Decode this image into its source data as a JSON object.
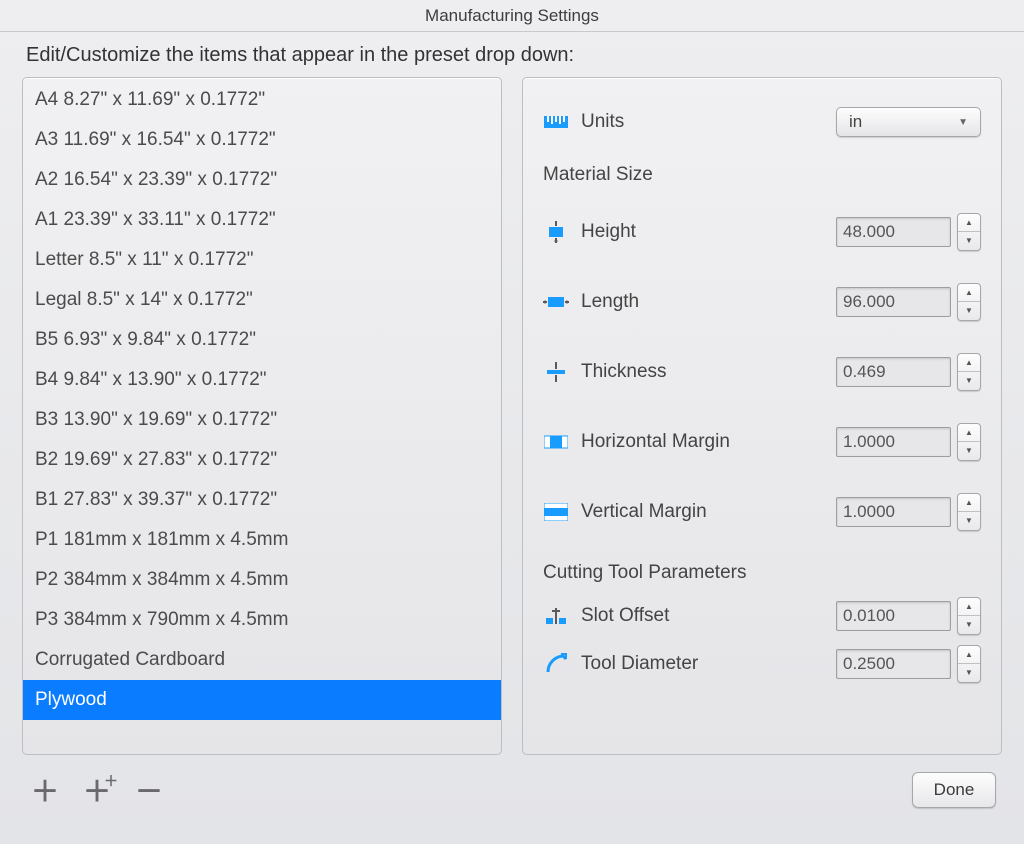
{
  "title": "Manufacturing Settings",
  "instruction": "Edit/Customize the items that appear in the preset drop down:",
  "presets": [
    {
      "label": "A4 8.27\" x 11.69\" x 0.1772\"",
      "selected": false
    },
    {
      "label": "A3 11.69\" x 16.54\" x 0.1772\"",
      "selected": false
    },
    {
      "label": "A2 16.54\" x 23.39\" x 0.1772\"",
      "selected": false
    },
    {
      "label": "A1 23.39\" x 33.11\" x 0.1772\"",
      "selected": false
    },
    {
      "label": "Letter 8.5\" x 11\" x 0.1772\"",
      "selected": false
    },
    {
      "label": "Legal 8.5\" x 14\" x 0.1772\"",
      "selected": false
    },
    {
      "label": "B5 6.93\" x 9.84\" x 0.1772\"",
      "selected": false
    },
    {
      "label": "B4 9.84\" x 13.90\" x 0.1772\"",
      "selected": false
    },
    {
      "label": "B3 13.90\" x 19.69\" x 0.1772\"",
      "selected": false
    },
    {
      "label": "B2 19.69\" x 27.83\" x 0.1772\"",
      "selected": false
    },
    {
      "label": "B1 27.83\" x 39.37\" x 0.1772\"",
      "selected": false
    },
    {
      "label": "P1 181mm x 181mm x 4.5mm",
      "selected": false
    },
    {
      "label": "P2 384mm x 384mm x 4.5mm",
      "selected": false
    },
    {
      "label": "P3 384mm x 790mm x 4.5mm",
      "selected": false
    },
    {
      "label": "Corrugated Cardboard",
      "selected": false
    },
    {
      "label": "Plywood",
      "selected": true
    }
  ],
  "form": {
    "units_label": "Units",
    "units_value": "in",
    "section_material_size": "Material Size",
    "height_label": "Height",
    "height_value": "48.000",
    "length_label": "Length",
    "length_value": "96.000",
    "thickness_label": "Thickness",
    "thickness_value": "0.469",
    "hmargin_label": "Horizontal Margin",
    "hmargin_value": "1.0000",
    "vmargin_label": "Vertical Margin",
    "vmargin_value": "1.0000",
    "section_cutting": "Cutting Tool Parameters",
    "slot_label": "Slot  Offset",
    "slot_value": "0.0100",
    "tool_label": "Tool Diameter",
    "tool_value": "0.2500"
  },
  "buttons": {
    "done": "Done"
  }
}
